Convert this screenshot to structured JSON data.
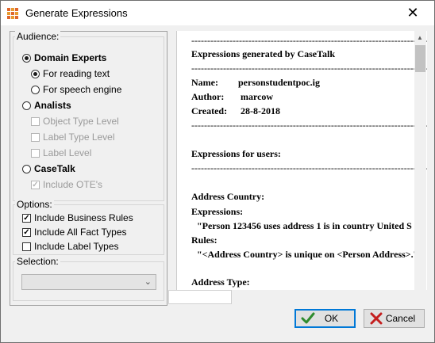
{
  "window": {
    "title": "Generate Expressions",
    "close_glyph": "✕",
    "icon": "grid-app-icon"
  },
  "audience": {
    "label": "Audience:",
    "domain_experts": "Domain Experts",
    "for_reading_text": "For reading text",
    "for_speech_engine": "For speech engine",
    "analists": "Analists",
    "object_type_level": "Object Type Level",
    "label_type_level": "Label Type Level",
    "label_level": "Label Level",
    "casetalk": "CaseTalk",
    "include_otes": "Include OTE's"
  },
  "options": {
    "label": "Options:",
    "include_business_rules": "Include Business Rules",
    "include_all_fact_types": "Include All Fact Types",
    "include_label_types": "Include Label Types"
  },
  "selection": {
    "label": "Selection:",
    "value": ""
  },
  "document": {
    "dashes": "------------------------------------------------------------------------------------",
    "heading": "Expressions generated by CaseTalk",
    "name_label": "Name:",
    "name_value": "personstudentpoc.ig",
    "author_label": "Author:",
    "author_value": "marcow",
    "created_label": "Created:",
    "created_value": "28-8-2018",
    "users_heading": "Expressions for users:",
    "address_country": "Address Country:",
    "expressions_label": "Expressions:",
    "expression_1": "\"Person 123456 uses address 1 is in country United S",
    "rules_label": "Rules:",
    "rule_1": "\"<Address Country> is unique on <Person Address>.'",
    "address_type": "Address Type:"
  },
  "buttons": {
    "ok": "OK",
    "cancel": "Cancel"
  },
  "colors": {
    "ok_border": "#0078d7",
    "checkmark": "#2e8b2e",
    "cancel_x": "#c41e1e"
  }
}
